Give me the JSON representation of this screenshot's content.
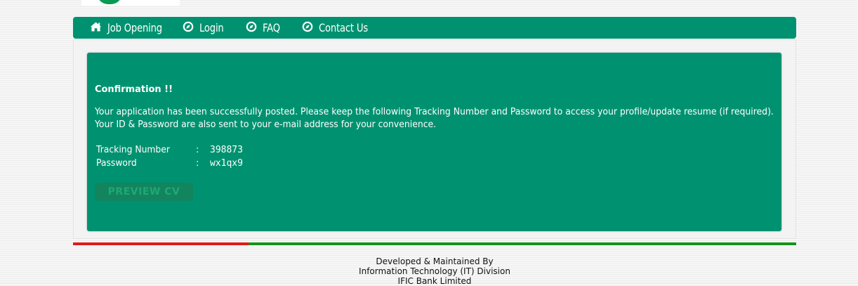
{
  "nav": {
    "items": [
      {
        "label": "Job Opening",
        "icon": "home-icon"
      },
      {
        "label": "Login",
        "icon": "compass-icon"
      },
      {
        "label": "FAQ",
        "icon": "compass-icon"
      },
      {
        "label": "Contact Us",
        "icon": "compass-icon"
      }
    ]
  },
  "confirmation": {
    "title": "Confirmation !!",
    "message_line1": "Your application has been successfully posted. Please keep the following Tracking Number and Password to access your profile/update resume (if required).",
    "message_line2": "Your ID & Password are also sent to your e-mail address for your convenience.",
    "tracking_label": "Tracking Number",
    "tracking_value": "398873",
    "password_label": "Password",
    "password_value": "wx1qx9",
    "separator": ":",
    "preview_button": "PREVIEW CV"
  },
  "footer": {
    "line1": "Developed & Maintained By",
    "line2": "Information Technology (IT) Division",
    "line3": "IFIC Bank Limited"
  },
  "colors": {
    "primary_green": "#009270",
    "divider_red": "#e01b1b",
    "divider_green": "#16941a"
  }
}
